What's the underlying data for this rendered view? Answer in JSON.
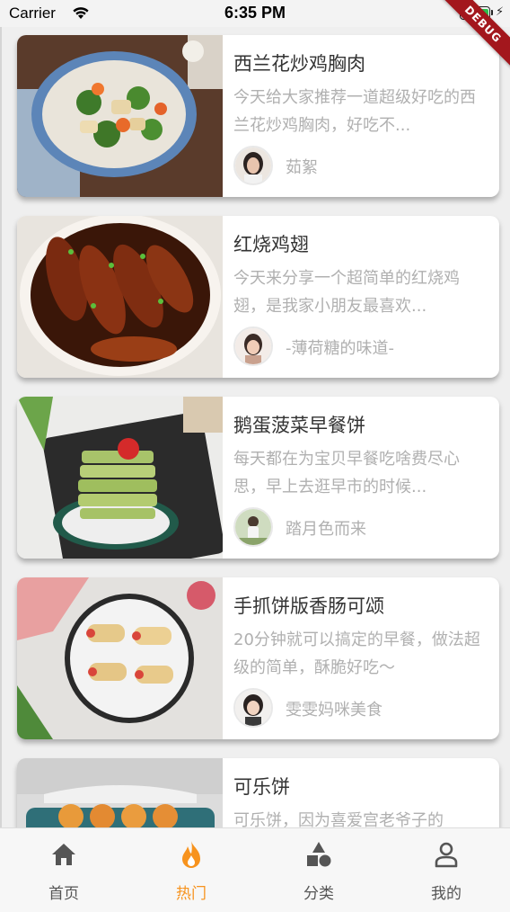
{
  "status_bar": {
    "carrier": "Carrier",
    "time": "6:35 PM"
  },
  "debug_banner": "DEBUG",
  "colors": {
    "accent": "#f7931e",
    "text_primary": "#333333",
    "text_secondary": "#b0b0b0"
  },
  "recipes": [
    {
      "title": "西兰花炒鸡胸肉",
      "desc": "今天给大家推荐一道超级好吃的西兰花炒鸡胸肉，好吃不...",
      "author": "茹絮"
    },
    {
      "title": "红烧鸡翅",
      "desc": "今天来分享一个超简单的红烧鸡翅，是我家小朋友最喜欢...",
      "author": "-薄荷糖的味道-"
    },
    {
      "title": "鹅蛋菠菜早餐饼",
      "desc": "每天都在为宝贝早餐吃啥费尽心思，早上去逛早市的时候...",
      "author": "踏月色而来"
    },
    {
      "title": "手抓饼版香肠可颂",
      "desc": "20分钟就可以搞定的早餐，做法超级的简单，酥脆好吃～",
      "author": "雯雯妈咪美食"
    },
    {
      "title": "可乐饼",
      "desc": "可乐饼，因为喜爱宫老爷子的",
      "author": ""
    }
  ],
  "tabs": [
    {
      "label": "首页",
      "icon": "home-icon"
    },
    {
      "label": "热门",
      "icon": "flame-icon"
    },
    {
      "label": "分类",
      "icon": "category-icon"
    },
    {
      "label": "我的",
      "icon": "profile-icon"
    }
  ]
}
